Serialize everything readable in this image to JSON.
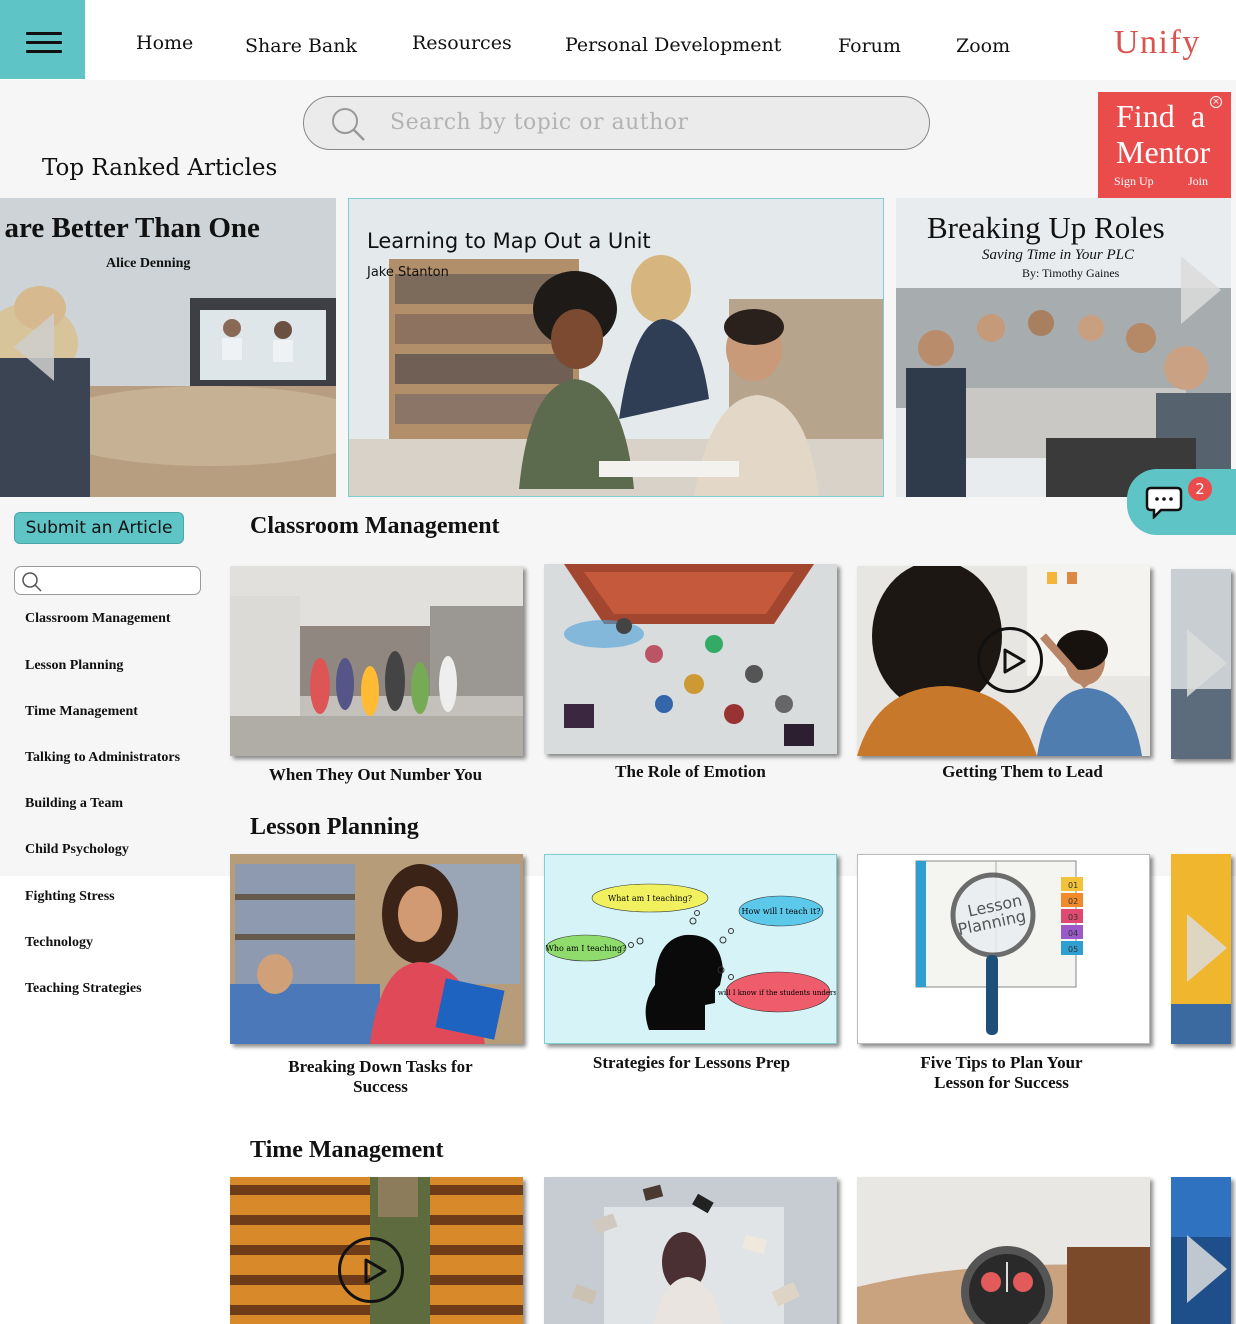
{
  "nav": {
    "items": [
      "Home",
      "Share Bank",
      "Resources",
      "Personal Development",
      "Forum",
      "Zoom"
    ],
    "brand": "Unify"
  },
  "search": {
    "placeholder": "Search by topic or author"
  },
  "mentor": {
    "line1a": "Find",
    "line1b": "a",
    "line2": "Mentor",
    "signup": "Sign Up",
    "join": "Join"
  },
  "top_ranked": {
    "heading": "Top Ranked Articles",
    "left": {
      "title": "s are Better Than One",
      "author": "Alice Denning"
    },
    "center": {
      "title": "Learning to Map Out a Unit",
      "author": "Jake Stanton"
    },
    "right": {
      "title": "Breaking Up Roles",
      "subtitle": "Saving Time in Your PLC",
      "byline": "By: Timothy Gaines"
    }
  },
  "chat": {
    "badge": "2"
  },
  "sidebar": {
    "submit_label": "Submit an Article",
    "categories": [
      "Classroom Management",
      "Lesson Planning",
      "Time Management",
      "Talking to Administrators",
      "Building a Team",
      "Child Psychology",
      "Fighting Stress",
      "Technology",
      "Teaching Strategies"
    ]
  },
  "sections": {
    "classroom": {
      "heading": "Classroom Management",
      "captions": [
        "When They Out Number You",
        "The Role of Emotion",
        "Getting Them to Lead"
      ]
    },
    "lesson": {
      "heading": "Lesson Planning",
      "captions": [
        "Breaking Down Tasks for Success",
        "Strategies for Lessons Prep",
        "Five Tips to Plan Your Lesson for Success"
      ],
      "mindmap": {
        "q1": "What am I teaching?",
        "q2": "How will I teach it?",
        "q3": "Who am I teaching?",
        "q4": "How will I know if the students understand?"
      },
      "book_word1": "Lesson",
      "book_word2": "Planning",
      "tabs": [
        "01",
        "02",
        "03",
        "04",
        "05"
      ]
    },
    "time": {
      "heading": "Time Management"
    }
  },
  "colors": {
    "accent": "#5fc4c6",
    "brand": "#d9534f",
    "mentor_bg": "#ea4c4c"
  }
}
